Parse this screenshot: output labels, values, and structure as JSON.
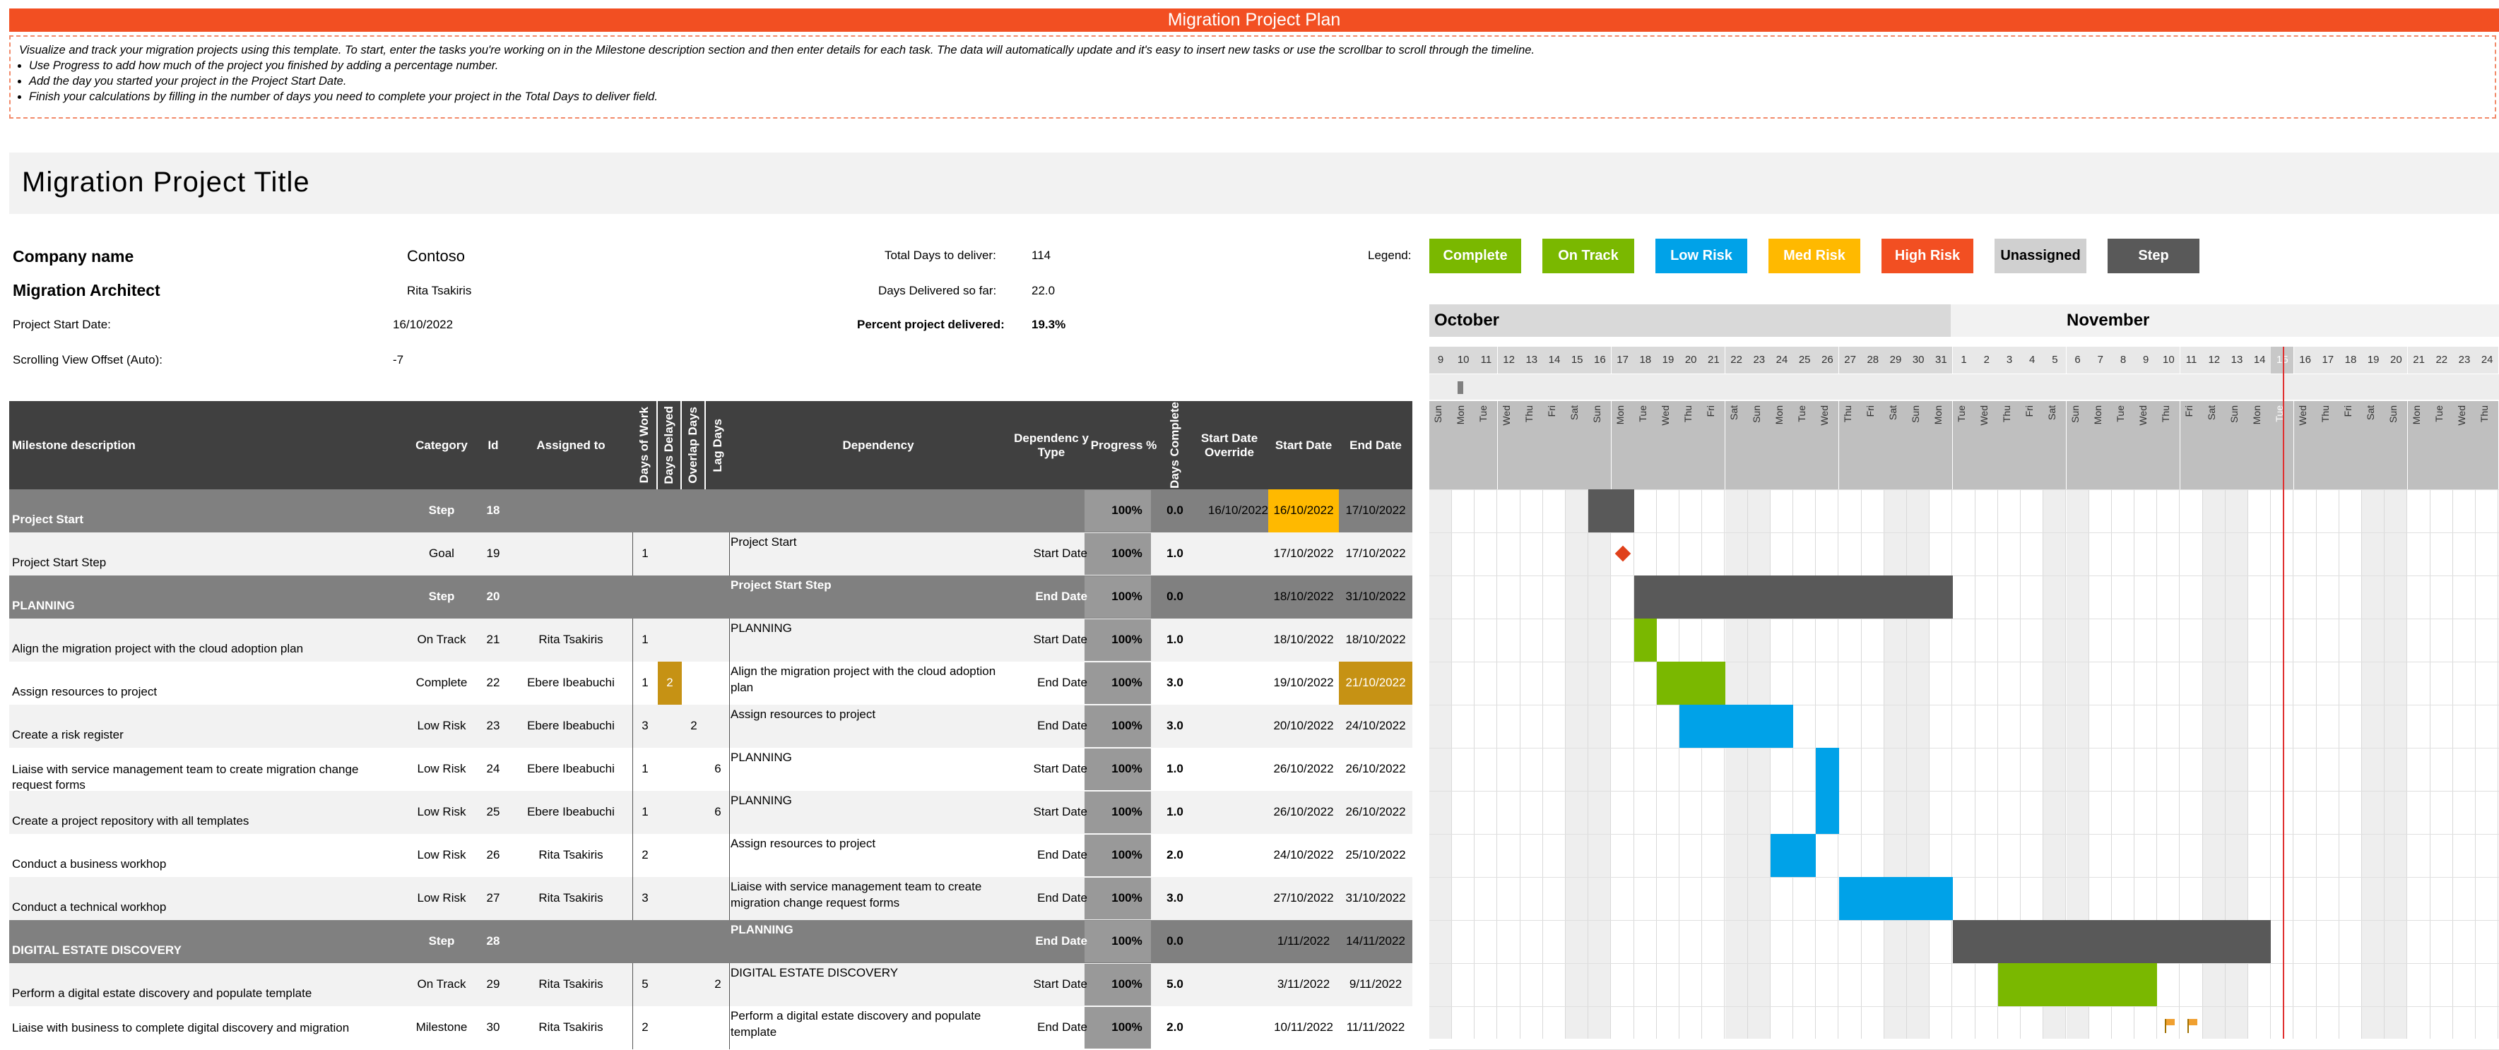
{
  "banner": "Migration Project Plan",
  "instructions": {
    "intro": "Visualize and track your migration projects using this template. To start, enter the tasks you're working on in the Milestone description section and then enter details for each task. The data will automatically update and it's easy to insert new tasks or use the scrollbar to scroll through the timeline.",
    "bullets": [
      "Use Progress to add how much of the project you finished by adding a percentage number.",
      "Add the day you started your project in the Project Start Date.",
      "Finish your calculations by filling in the number of days you need to complete your project in the Total Days to deliver field."
    ]
  },
  "project_title": "Migration Project Title",
  "info": {
    "company_label": "Company name",
    "company_value": "Contoso",
    "architect_label": "Migration Architect",
    "architect_value": "Rita Tsakiris",
    "start_label": "Project Start Date:",
    "start_value": "16/10/2022",
    "offset_label": "Scrolling View Offset (Auto):",
    "offset_value": "-7",
    "total_label": "Total Days to deliver:",
    "total_value": "114",
    "delivered_label": "Days Delivered so far:",
    "delivered_value": "22.0",
    "percent_label": "Percent project delivered:",
    "percent_value": "19.3%"
  },
  "legend": {
    "label": "Legend:",
    "items": [
      {
        "text": "Complete",
        "color": "#7ab800"
      },
      {
        "text": "On Track",
        "color": "#7ab800"
      },
      {
        "text": "Low Risk",
        "color": "#00a2e8"
      },
      {
        "text": "Med Risk",
        "color": "#ffb900"
      },
      {
        "text": "High Risk",
        "color": "#f24f22"
      },
      {
        "text": "Unassigned",
        "color": "#d0d0d0"
      },
      {
        "text": "Step",
        "color": "#595959"
      }
    ]
  },
  "headers": {
    "milestone": "Milestone description",
    "category": "Category",
    "id": "Id",
    "assigned": "Assigned to",
    "dow": "Days of Work",
    "delayed": "Days Delayed",
    "overlap": "Overlap Days",
    "lag": "Lag Days",
    "dependency": "Dependency",
    "deptype": "Dependenc y Type",
    "progress": "Progress %",
    "daysc": "Days Complete",
    "override": "Start Date Override",
    "start": "Start Date",
    "end": "End Date"
  },
  "timeline": {
    "months": [
      "October",
      "November"
    ],
    "days": [
      "9",
      "10",
      "11",
      "12",
      "13",
      "14",
      "15",
      "16",
      "17",
      "18",
      "19",
      "20",
      "21",
      "22",
      "23",
      "24",
      "25",
      "26",
      "27",
      "28",
      "29",
      "30",
      "31",
      "1",
      "2",
      "3",
      "4",
      "5",
      "6",
      "7",
      "8",
      "9",
      "10",
      "11",
      "12",
      "13",
      "14",
      "15",
      "16",
      "17",
      "18",
      "19",
      "20",
      "21",
      "22",
      "23",
      "24"
    ],
    "day_names": [
      "Sun",
      "Mon",
      "Tue",
      "Wed",
      "Thu",
      "Fri",
      "Sat",
      "Sun",
      "Mon",
      "Tue",
      "Wed",
      "Thu",
      "Fri",
      "Sat",
      "Sun",
      "Mon",
      "Tue",
      "Wed",
      "Thu",
      "Fri",
      "Sat",
      "Sun",
      "Mon",
      "Tue",
      "Wed",
      "Thu",
      "Fri",
      "Sat",
      "Sun",
      "Mon",
      "Tue",
      "Wed",
      "Thu",
      "Fri",
      "Sat",
      "Sun",
      "Mon",
      "Tue",
      "Wed",
      "Thu",
      "Fri",
      "Sat",
      "Sun",
      "Mon",
      "Tue",
      "Wed",
      "Thu"
    ],
    "today_index": 37
  },
  "rows": [
    {
      "name": "Project Start",
      "cat": "Step",
      "id": "18",
      "assigned": "",
      "dow": "",
      "del": "",
      "ovl": "",
      "lag": "",
      "dep": "",
      "deptype": "",
      "prog": "100%",
      "dc": "0.0",
      "ovr": "16/10/2022",
      "start": "16/10/2022",
      "end": "17/10/2022",
      "step": true,
      "bar": {
        "from": 7,
        "to": 9,
        "color": "#595959"
      }
    },
    {
      "name": "Project Start Step",
      "cat": "Goal",
      "id": "19",
      "assigned": "",
      "dow": "1",
      "del": "",
      "ovl": "",
      "lag": "",
      "dep": "Project Start",
      "deptype": "Start Date",
      "prog": "100%",
      "dc": "1.0",
      "ovr": "",
      "start": "17/10/2022",
      "end": "17/10/2022",
      "diamond": 8.5
    },
    {
      "name": "PLANNING",
      "cat": "Step",
      "id": "20",
      "assigned": "",
      "dow": "",
      "del": "",
      "ovl": "",
      "lag": "",
      "dep": "Project Start Step",
      "deptype": "End Date",
      "prog": "100%",
      "dc": "0.0",
      "ovr": "",
      "start": "18/10/2022",
      "end": "31/10/2022",
      "step": true,
      "bar": {
        "from": 9,
        "to": 23,
        "color": "#595959"
      }
    },
    {
      "name": "Align the migration project with the cloud adoption plan",
      "cat": "On Track",
      "id": "21",
      "assigned": "Rita Tsakiris",
      "dow": "1",
      "del": "",
      "ovl": "",
      "lag": "",
      "dep": "PLANNING",
      "deptype": "Start Date",
      "prog": "100%",
      "dc": "1.0",
      "ovr": "",
      "start": "18/10/2022",
      "end": "18/10/2022",
      "bar": {
        "from": 9,
        "to": 10,
        "color": "#7ab800"
      }
    },
    {
      "name": "Assign resources to project",
      "cat": "Complete",
      "id": "22",
      "assigned": "Ebere Ibeabuchi",
      "dow": "1",
      "del": "2",
      "ovl": "",
      "lag": "",
      "dep": "Align the migration project with the cloud adoption plan",
      "deptype": "End Date",
      "prog": "100%",
      "dc": "3.0",
      "ovr": "",
      "start": "19/10/2022",
      "end": "21/10/2022",
      "bar": {
        "from": 10,
        "to": 13,
        "color": "#7ab800"
      },
      "hl": true
    },
    {
      "name": "Create a risk register",
      "cat": "Low Risk",
      "id": "23",
      "assigned": "Ebere Ibeabuchi",
      "dow": "3",
      "del": "",
      "ovl": "2",
      "lag": "",
      "dep": "Assign resources to project",
      "deptype": "End Date",
      "prog": "100%",
      "dc": "3.0",
      "ovr": "",
      "start": "20/10/2022",
      "end": "24/10/2022",
      "bar": {
        "from": 11,
        "to": 16,
        "color": "#00a2e8"
      }
    },
    {
      "name": "Liaise with service management team to create migration change request forms",
      "cat": "Low Risk",
      "id": "24",
      "assigned": "Ebere Ibeabuchi",
      "dow": "1",
      "del": "",
      "ovl": "",
      "lag": "6",
      "dep": "PLANNING",
      "deptype": "Start Date",
      "prog": "100%",
      "dc": "1.0",
      "ovr": "",
      "start": "26/10/2022",
      "end": "26/10/2022",
      "bar": {
        "from": 17,
        "to": 18,
        "color": "#00a2e8"
      }
    },
    {
      "name": "Create a project repository with all templates",
      "cat": "Low Risk",
      "id": "25",
      "assigned": "Ebere Ibeabuchi",
      "dow": "1",
      "del": "",
      "ovl": "",
      "lag": "6",
      "dep": "PLANNING",
      "deptype": "Start Date",
      "prog": "100%",
      "dc": "1.0",
      "ovr": "",
      "start": "26/10/2022",
      "end": "26/10/2022",
      "bar": {
        "from": 17,
        "to": 18,
        "color": "#00a2e8"
      }
    },
    {
      "name": "Conduct a business workhop",
      "cat": "Low Risk",
      "id": "26",
      "assigned": "Rita Tsakiris",
      "dow": "2",
      "del": "",
      "ovl": "",
      "lag": "",
      "dep": "Assign resources to project",
      "deptype": "End Date",
      "prog": "100%",
      "dc": "2.0",
      "ovr": "",
      "start": "24/10/2022",
      "end": "25/10/2022",
      "bar": {
        "from": 15,
        "to": 17,
        "color": "#00a2e8"
      }
    },
    {
      "name": "Conduct a technical workhop",
      "cat": "Low Risk",
      "id": "27",
      "assigned": "Rita Tsakiris",
      "dow": "3",
      "del": "",
      "ovl": "",
      "lag": "",
      "dep": "Liaise with service management team to create migration change request forms",
      "deptype": "End Date",
      "prog": "100%",
      "dc": "3.0",
      "ovr": "",
      "start": "27/10/2022",
      "end": "31/10/2022",
      "bar": {
        "from": 18,
        "to": 23,
        "color": "#00a2e8"
      }
    },
    {
      "name": "DIGITAL ESTATE DISCOVERY",
      "cat": "Step",
      "id": "28",
      "assigned": "",
      "dow": "",
      "del": "",
      "ovl": "",
      "lag": "",
      "dep": "PLANNING",
      "deptype": "End Date",
      "prog": "100%",
      "dc": "0.0",
      "ovr": "",
      "start": "1/11/2022",
      "end": "14/11/2022",
      "step": true,
      "bar": {
        "from": 23,
        "to": 37,
        "color": "#595959"
      }
    },
    {
      "name": "Perform a digital estate discovery and populate template",
      "cat": "On Track",
      "id": "29",
      "assigned": "Rita Tsakiris",
      "dow": "5",
      "del": "",
      "ovl": "",
      "lag": "2",
      "dep": "DIGITAL ESTATE DISCOVERY",
      "deptype": "Start Date",
      "prog": "100%",
      "dc": "5.0",
      "ovr": "",
      "start": "3/11/2022",
      "end": "9/11/2022",
      "bar": {
        "from": 25,
        "to": 32,
        "color": "#7ab800"
      }
    },
    {
      "name": "Liaise with business to complete digital discovery and migration",
      "cat": "Milestone",
      "id": "30",
      "assigned": "Rita Tsakiris",
      "dow": "2",
      "del": "",
      "ovl": "",
      "lag": "",
      "dep": "Perform a digital estate discovery and populate template",
      "deptype": "End Date",
      "prog": "100%",
      "dc": "2.0",
      "ovr": "",
      "start": "10/11/2022",
      "end": "11/11/2022",
      "flags": [
        32.5,
        33.5
      ]
    }
  ]
}
